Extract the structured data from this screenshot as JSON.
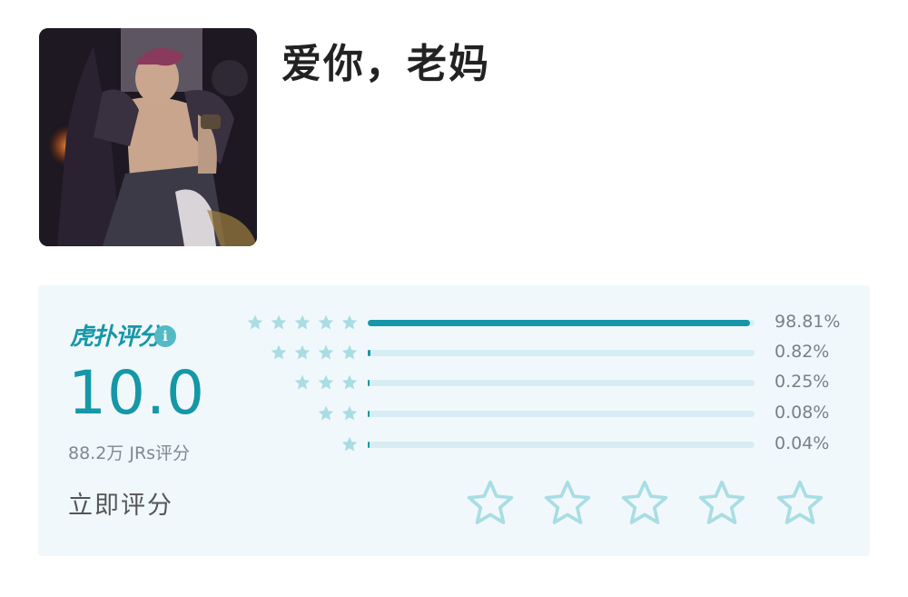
{
  "title": "爱你，老妈",
  "rating": {
    "brand": "虎扑评分",
    "score": "10.0",
    "count": "88.2万 JRs评分",
    "rate_label": "立即评分",
    "distribution": [
      {
        "stars": 5,
        "fraction": 0.9881,
        "label": "98.81%"
      },
      {
        "stars": 4,
        "fraction": 0.0082,
        "label": "0.82%"
      },
      {
        "stars": 3,
        "fraction": 0.0025,
        "label": "0.25%"
      },
      {
        "stars": 2,
        "fraction": 0.0008,
        "label": "0.08%"
      },
      {
        "stars": 1,
        "fraction": 0.0004,
        "label": "0.04%"
      }
    ],
    "user_rating": 0,
    "max_stars": 5
  },
  "colors": {
    "accent": "#1597a8",
    "star_light": "#a9dde4",
    "panel_bg": "#f1f8fb",
    "track": "#d6eef3"
  },
  "icons": {
    "info": "info-icon",
    "star": "star-icon"
  }
}
